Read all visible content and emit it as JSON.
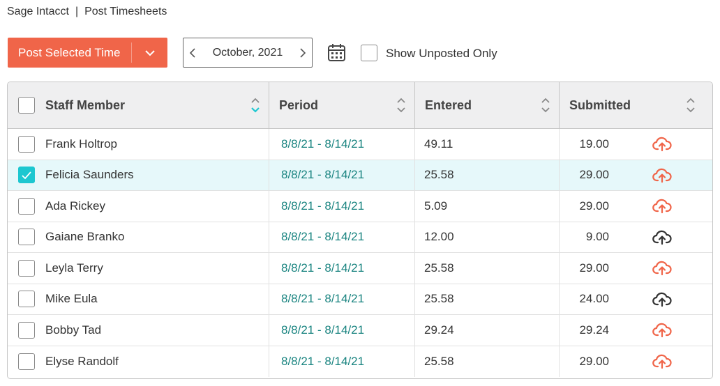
{
  "breadcrumb": {
    "app": "Sage Intacct",
    "separator": "|",
    "page": "Post Timesheets"
  },
  "toolbar": {
    "post_label": "Post Selected Time",
    "date_value": "October, 2021",
    "unposted_label": "Show Unposted Only",
    "unposted_checked": false
  },
  "colors": {
    "accent": "#f06549",
    "teal_link": "#1a8480",
    "selected_row": "#e6f8fa",
    "checkbox_on": "#1cc7d0"
  },
  "table": {
    "headers": {
      "staff": "Staff Member",
      "period": "Period",
      "entered": "Entered",
      "submitted": "Submitted"
    },
    "rows": [
      {
        "name": "Frank Holtrop",
        "period": "8/8/21 - 8/14/21",
        "entered": "49.11",
        "submitted": "19.00",
        "checked": false,
        "icon": "cloud-upload-orange"
      },
      {
        "name": "Felicia Saunders",
        "period": "8/8/21 - 8/14/21",
        "entered": "25.58",
        "submitted": "29.00",
        "checked": true,
        "icon": "cloud-upload-orange"
      },
      {
        "name": "Ada Rickey",
        "period": "8/8/21 - 8/14/21",
        "entered": "5.09",
        "submitted": "29.00",
        "checked": false,
        "icon": "cloud-upload-orange"
      },
      {
        "name": "Gaiane Branko",
        "period": "8/8/21 - 8/14/21",
        "entered": "12.00",
        "submitted": "9.00",
        "checked": false,
        "icon": "cloud-upload-dark"
      },
      {
        "name": "Leyla Terry",
        "period": "8/8/21 - 8/14/21",
        "entered": "25.58",
        "submitted": "29.00",
        "checked": false,
        "icon": "cloud-upload-orange"
      },
      {
        "name": "Mike Eula",
        "period": "8/8/21 - 8/14/21",
        "entered": "25.58",
        "submitted": "24.00",
        "checked": false,
        "icon": "cloud-upload-dark"
      },
      {
        "name": "Bobby Tad",
        "period": "8/8/21 - 8/14/21",
        "entered": "29.24",
        "submitted": "29.24",
        "checked": false,
        "icon": "cloud-upload-orange"
      },
      {
        "name": "Elyse Randolf",
        "period": "8/8/21 - 8/14/21",
        "entered": "25.58",
        "submitted": "29.00",
        "checked": false,
        "icon": "cloud-upload-orange"
      }
    ]
  }
}
